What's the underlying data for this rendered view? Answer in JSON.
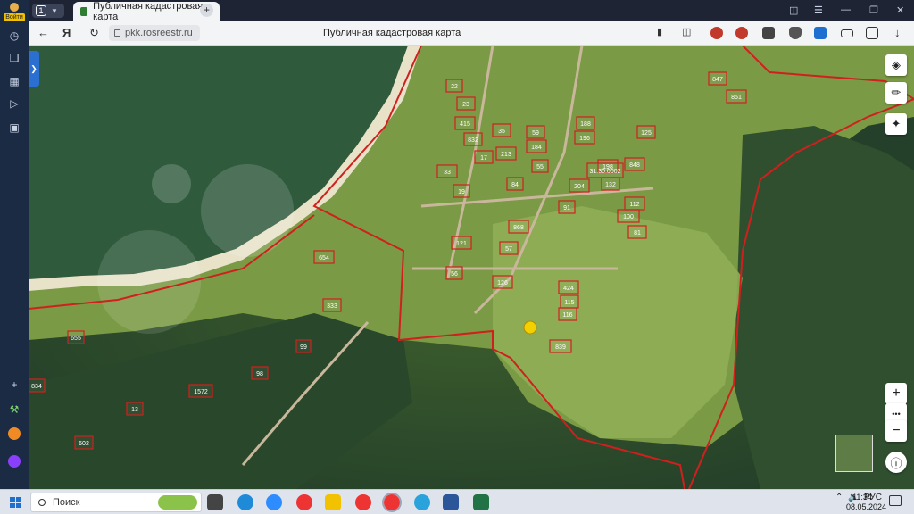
{
  "rail": {
    "login_label": "Войти",
    "items": [
      "clock-icon",
      "collections-icon",
      "bookmark-icon",
      "video-icon",
      "screenshot-icon"
    ],
    "bottom": [
      "add-icon",
      "shortcut-icon",
      "mail-icon",
      "alice-icon"
    ]
  },
  "tabs": {
    "count": "1",
    "active_title": "Публичная кадастровая карта"
  },
  "navbar": {
    "url": "pkk.rosreestr.ru",
    "page_title": "Публичная кадастровая карта"
  },
  "map": {
    "parcels": [
      {
        "label": "22"
      },
      {
        "label": "23"
      },
      {
        "label": "415"
      },
      {
        "label": "832"
      },
      {
        "label": "35"
      },
      {
        "label": "59"
      },
      {
        "label": "184"
      },
      {
        "label": "188"
      },
      {
        "label": "196"
      },
      {
        "label": "213"
      },
      {
        "label": "17"
      },
      {
        "label": "33"
      },
      {
        "label": "19"
      },
      {
        "label": "55"
      },
      {
        "label": "84"
      },
      {
        "label": "204"
      },
      {
        "label": "198"
      },
      {
        "label": "848"
      },
      {
        "label": "132"
      },
      {
        "label": "91"
      },
      {
        "label": "31:30:0002"
      },
      {
        "label": "112"
      },
      {
        "label": "100"
      },
      {
        "label": "121"
      },
      {
        "label": "868"
      },
      {
        "label": "57"
      },
      {
        "label": "56"
      },
      {
        "label": "126"
      },
      {
        "label": "424"
      },
      {
        "label": "115"
      },
      {
        "label": "116"
      },
      {
        "label": "839"
      },
      {
        "label": "654"
      },
      {
        "label": "333"
      },
      {
        "label": "99"
      },
      {
        "label": "98"
      },
      {
        "label": "1572"
      },
      {
        "label": "13"
      },
      {
        "label": "602"
      },
      {
        "label": "655"
      },
      {
        "label": "834"
      },
      {
        "label": "847"
      },
      {
        "label": "851"
      },
      {
        "label": "125"
      },
      {
        "label": "81"
      }
    ]
  },
  "map_tools": [
    "layers-icon",
    "ruler-icon",
    "locate-icon"
  ],
  "zoom": {
    "in": "+",
    "more": "•••",
    "out": "−"
  },
  "taskbar": {
    "search_label": "Поиск",
    "language": "РУС",
    "time": "11:34",
    "date": "08.05.2024"
  }
}
